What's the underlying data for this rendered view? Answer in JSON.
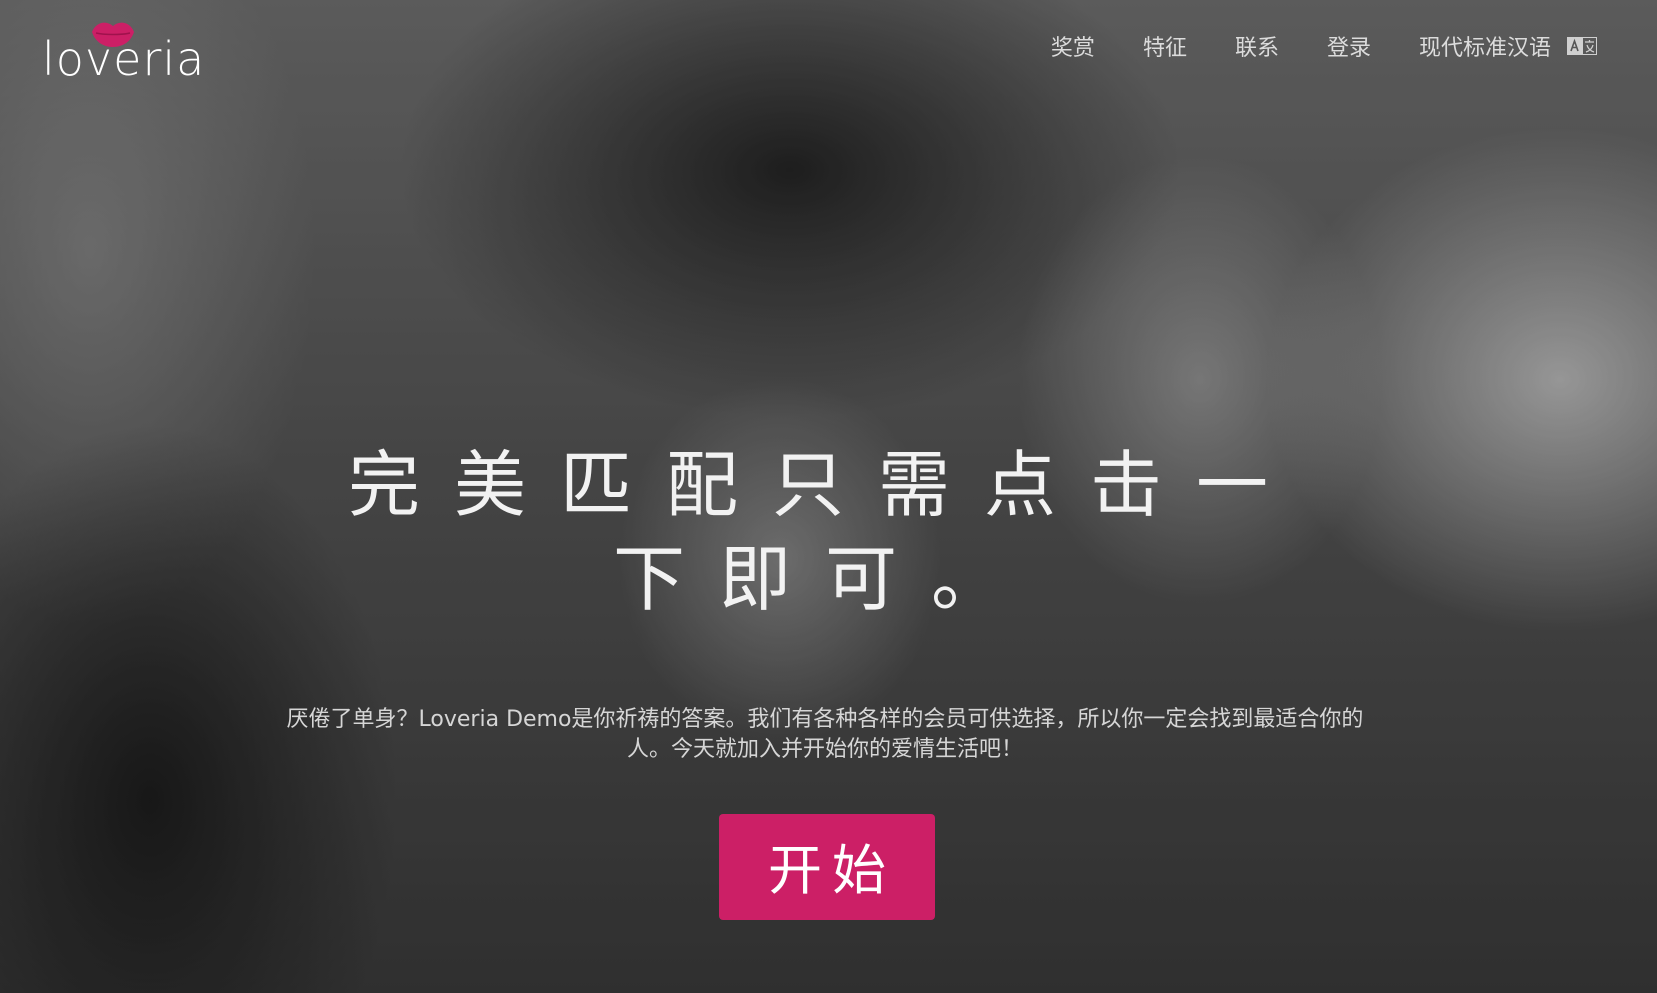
{
  "brand": {
    "name": "loveria",
    "accent_color": "#cc1f66",
    "logo_icon": "lips-icon"
  },
  "nav": {
    "items": [
      {
        "label": "奖赏"
      },
      {
        "label": "特征"
      },
      {
        "label": "联系"
      },
      {
        "label": "登录"
      }
    ],
    "language": {
      "label": "现代标准汉语",
      "icon": "translate-icon"
    }
  },
  "hero": {
    "headline": "完美匹配只需点击一下即可。",
    "subtext": "厌倦了单身？Loveria Demo是你祈祷的答案。我们有各种各样的会员可供选择，所以你一定会找到最适合你的人。今天就加入并开始你的爱情生活吧！",
    "cta_label": "开始"
  }
}
